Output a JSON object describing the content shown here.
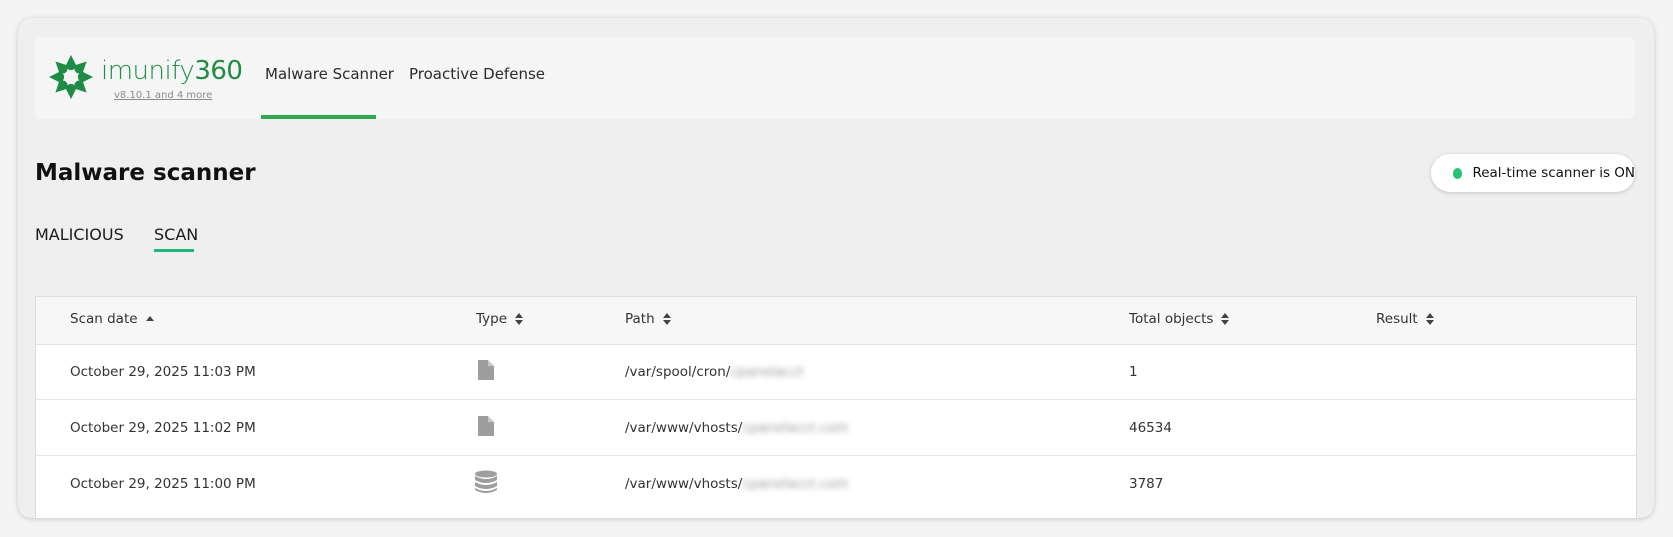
{
  "brand": {
    "name_light": "imunify",
    "name_bold": "360",
    "version": "v8.10.1 and 4 more",
    "color": "#1e8c45"
  },
  "nav": {
    "tabs": [
      {
        "label": "Malware Scanner",
        "active": true
      },
      {
        "label": "Proactive Defense",
        "active": false
      }
    ],
    "accent": "#2fa84f"
  },
  "page": {
    "title": "Malware scanner"
  },
  "realtime": {
    "label": "Real-time scanner is ON",
    "status_color": "#27c27a"
  },
  "subtabs": [
    {
      "label": "MALICIOUS",
      "active": false
    },
    {
      "label": "SCAN",
      "active": true
    }
  ],
  "table": {
    "columns": [
      {
        "label": "Scan date",
        "sort": "asc"
      },
      {
        "label": "Type",
        "sort": "both"
      },
      {
        "label": "Path",
        "sort": "both"
      },
      {
        "label": "Total objects",
        "sort": "both"
      },
      {
        "label": "Result",
        "sort": "both"
      }
    ],
    "rows": [
      {
        "date": "October 29, 2025 11:03 PM",
        "type_icon": "file-icon",
        "path": "/var/spool/cron/",
        "path_redacted": "cpanelacct",
        "total": "1",
        "result": ""
      },
      {
        "date": "October 29, 2025 11:02 PM",
        "type_icon": "file-icon",
        "path": "/var/www/vhosts/",
        "path_redacted": "cpanelacct.com",
        "total": "46534",
        "result": ""
      },
      {
        "date": "October 29, 2025 11:00 PM",
        "type_icon": "database-icon",
        "path": "/var/www/vhosts/",
        "path_redacted": "cpanelacct.com",
        "total": "3787",
        "result": ""
      }
    ]
  }
}
